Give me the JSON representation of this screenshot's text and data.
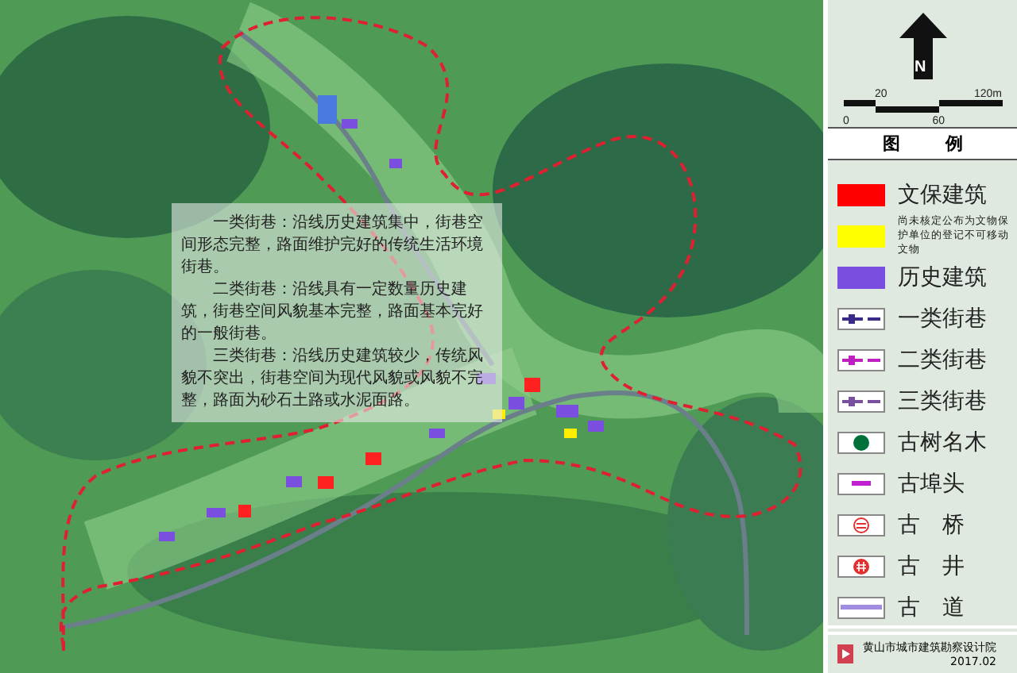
{
  "map": {
    "description": [
      "一类街巷：沿线历史建筑集中，街巷空间形态完整，路面维护完好的传统生活环境街巷。",
      "二类街巷：沿线具有一定数量历史建筑，街巷空间风貌基本完整，路面基本完好的一般街巷。",
      "三类街巷：沿线历史建筑较少，传统风貌不突出，街巷空间为现代风貌或风貌不完整，路面为砂石土路或水泥面路。"
    ]
  },
  "legend": {
    "compass_label": "N",
    "scale": {
      "top_ticks": [
        "20",
        "120m"
      ],
      "bottom_ticks": [
        "0",
        "60"
      ]
    },
    "title": [
      "图",
      "例"
    ],
    "items": [
      {
        "kind": "fill",
        "color": "#ff0000",
        "label": "文保建筑"
      },
      {
        "kind": "fill",
        "color": "#ffff00",
        "label": "尚未核定公布为文物保护单位的登记不可移动文物"
      },
      {
        "kind": "fill",
        "color": "#7a4fe0",
        "label": "历史建筑"
      },
      {
        "kind": "street",
        "color": "#3a2a8a",
        "label": "一类街巷"
      },
      {
        "kind": "street",
        "color": "#c020c0",
        "label": "二类街巷"
      },
      {
        "kind": "street",
        "color": "#7a4fa0",
        "label": "三类街巷"
      },
      {
        "kind": "tree",
        "color": "#00703a",
        "label": "古树名木"
      },
      {
        "kind": "pier",
        "color": "#c020d0",
        "label": "古埠头"
      },
      {
        "kind": "bridge",
        "color": "#e03030",
        "label": "古　桥"
      },
      {
        "kind": "well",
        "color": "#e03030",
        "label": "古　井"
      },
      {
        "kind": "road",
        "color": "#a08ce0",
        "label": "古　道"
      }
    ]
  },
  "credit": {
    "org": "黄山市城市建筑勘察设计院",
    "date": "2017.02"
  }
}
